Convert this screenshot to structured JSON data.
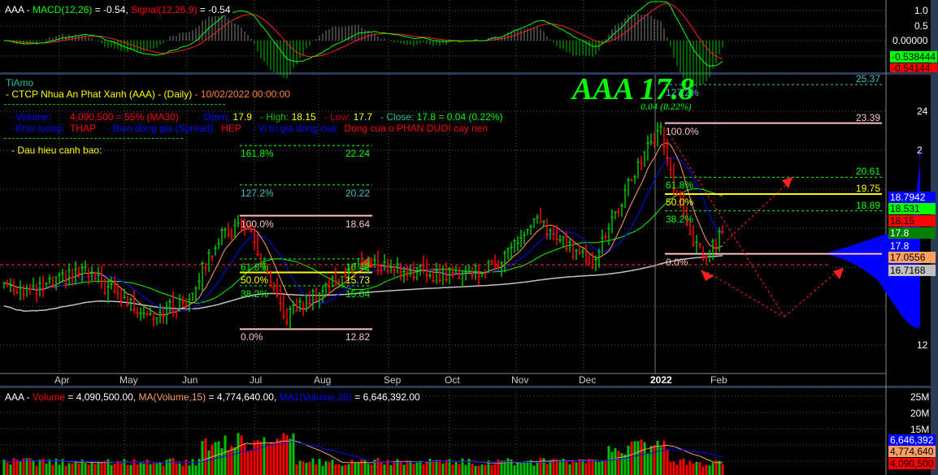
{
  "macd_pane": {
    "symbol": "AAA - ",
    "macd_label": "MACD(12,26)",
    "macd_value": " = -0.54, ",
    "signal_label": "Signal(12,26,9)",
    "signal_value": " = -0.54",
    "axis_ticks": [
      "1.0",
      "0.5",
      "0.00000"
    ],
    "tag_macd": "-0.538444",
    "tag_signal": "-0.54144"
  },
  "price_pane": {
    "brand": "TiAmo",
    "title": "- CTCP Nhua An Phat Xanh (AAA) - (Daily)",
    "datetime": " - 10/02/2022 00:00:00",
    "row1": {
      "vol_label": "- Volume:",
      "vol_value": "4,090,500  =  55%  (MA30)",
      "open_label": "- Open:",
      "open_value": "17.9",
      "high_label": "- High:",
      "high_value": "18.15",
      "low_label": "- Low:",
      "low_value": "17.7",
      "close_label": "- Close:",
      "close_value": "17.8  =  0.04  (0.22%)"
    },
    "row2": {
      "kl_label": "- Khoi luong:",
      "kl_value": "THAP",
      "spread_label": "-   Bien dong gia (Spread):",
      "spread_value": "HEP",
      "pos_label": "-   Vi tri gia dong cua:",
      "pos_value": "Dong cua o PHAN DUOI cay nen"
    },
    "warning_label": "- Dau hieu canh bao:",
    "big_ticker": "AAA 17.8",
    "big_change": "0.04 (0.22%)",
    "axis_ticks": [
      "24",
      "2",
      "12"
    ],
    "months": [
      "Apr",
      "May",
      "Jun",
      "Jul",
      "Aug",
      "Sep",
      "Oct",
      "Nov",
      "Dec",
      "2022",
      "Feb"
    ],
    "tags": [
      {
        "text": "18.7942",
        "bg": "#0000ff",
        "fg": "#ffffff"
      },
      {
        "text": "18.531",
        "bg": "#00ff00",
        "fg": "#000000"
      },
      {
        "text": "18.15",
        "bg": "#ff0000",
        "fg": "#000000"
      },
      {
        "text": "17.8",
        "bg": "#008000",
        "fg": "#ffffff"
      },
      {
        "text": "17.8",
        "bg": "transparent",
        "fg": "#ffffff"
      },
      {
        "text": "17.0556",
        "bg": "#ffa060",
        "fg": "#000000"
      },
      {
        "text": "16.7168",
        "bg": "#c0c0c0",
        "fg": "#000000"
      }
    ]
  },
  "volume_pane": {
    "symbol": "AAA - ",
    "vol_label": "Volume",
    "vol_value": " = 4,090,500.00, ",
    "ma_label": "MA(Volume,15)",
    "ma_value": " = 4,774,640.00, ",
    "ma1_label": "MA1(Volume,25)",
    "ma1_value": " = 6,646,392.00",
    "axis_ticks": [
      "25M",
      "20M",
      "15M"
    ],
    "tags": [
      {
        "text": "6,646,392",
        "bg": "#0000ff",
        "fg": "#ffffff"
      },
      {
        "text": "4,774,640",
        "bg": "#ffa060",
        "fg": "#000000"
      },
      {
        "text": "4,090,500",
        "bg": "#ff0000",
        "fg": "#000000"
      }
    ]
  },
  "chart_data": {
    "type": "candlestick",
    "symbol": "AAA",
    "ylim": [
      11.5,
      26
    ],
    "price_anchors": [
      [
        0,
        15.2
      ],
      [
        9,
        14.7
      ],
      [
        24,
        15.8
      ],
      [
        40,
        14.0
      ],
      [
        46,
        13.6
      ],
      [
        56,
        14.2
      ],
      [
        66,
        17.5
      ],
      [
        74,
        18.3
      ],
      [
        86,
        13.4
      ],
      [
        99,
        15.0
      ],
      [
        109,
        16.2
      ],
      [
        119,
        16.0
      ],
      [
        134,
        15.6
      ],
      [
        149,
        15.9
      ],
      [
        164,
        18.3
      ],
      [
        174,
        17.0
      ],
      [
        181,
        16.3
      ],
      [
        189,
        19.0
      ],
      [
        196,
        21.6
      ],
      [
        202,
        23.1
      ],
      [
        206,
        20.2
      ],
      [
        211,
        17.5
      ],
      [
        216,
        16.5
      ],
      [
        221,
        17.8
      ]
    ],
    "fib_left": [
      {
        "pct": "161.8%",
        "price": 22.24
      },
      {
        "pct": "127.2%",
        "price": 20.22
      },
      {
        "pct": "100.0%",
        "price": 18.64
      },
      {
        "pct": "61.8%",
        "price": 16.42
      },
      {
        "pct": "50.0%",
        "price": 15.73
      },
      {
        "pct": "38.2%",
        "price": 15.04
      },
      {
        "pct": "0.0%",
        "price": 12.82
      }
    ],
    "fib_right": [
      {
        "pct": "127.2%",
        "price": 25.37
      },
      {
        "pct": "100.0%",
        "price": 23.39
      },
      {
        "pct": "61.8%",
        "price": 20.61
      },
      {
        "pct": "50.0%",
        "price": 19.75
      },
      {
        "pct": "38.2%",
        "price": 18.89
      },
      {
        "pct": "0.0%",
        "price": 16.68
      }
    ],
    "macd_params": [
      12,
      26,
      9
    ],
    "volume_ylim": [
      0,
      25000000
    ],
    "colors": {
      "up": "#00c000",
      "down": "#ff0000",
      "ma_fast": "#ffa060",
      "ma_mid": "#0000ff",
      "ma_slow": "#00ff00",
      "ma_long": "#c0c0c0"
    }
  }
}
